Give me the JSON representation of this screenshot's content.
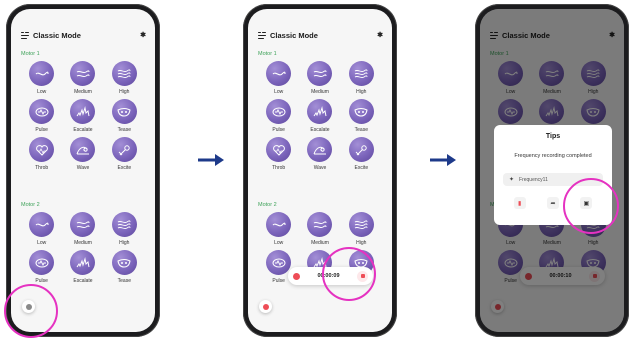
{
  "app": {
    "title": "Classic Mode",
    "bluetooth_icon": "bluetooth-wave-icon"
  },
  "sections": {
    "motor1": "Motor 1",
    "motor2": "Motor 2"
  },
  "motor1_modes": [
    "Low",
    "Medium",
    "High",
    "Pulse",
    "Escalate",
    "Tease",
    "Throb",
    "Wave",
    "Excite"
  ],
  "motor2_modes": [
    "Low",
    "Medium",
    "High",
    "Pulse",
    "Escalate",
    "Tease"
  ],
  "recording": {
    "time_screen2": "00:00:09",
    "time_screen3": "00:00:10"
  },
  "tips": {
    "title": "Tips",
    "message": "Frequency recording completed",
    "file_name": "Frequency11"
  },
  "colors": {
    "accent_green": "#3fa25a",
    "mode_purple": "#7b64bb",
    "record_red": "#ee4d57",
    "highlight_magenta": "#e532c1",
    "arrow_navy": "#1d3a8a"
  }
}
